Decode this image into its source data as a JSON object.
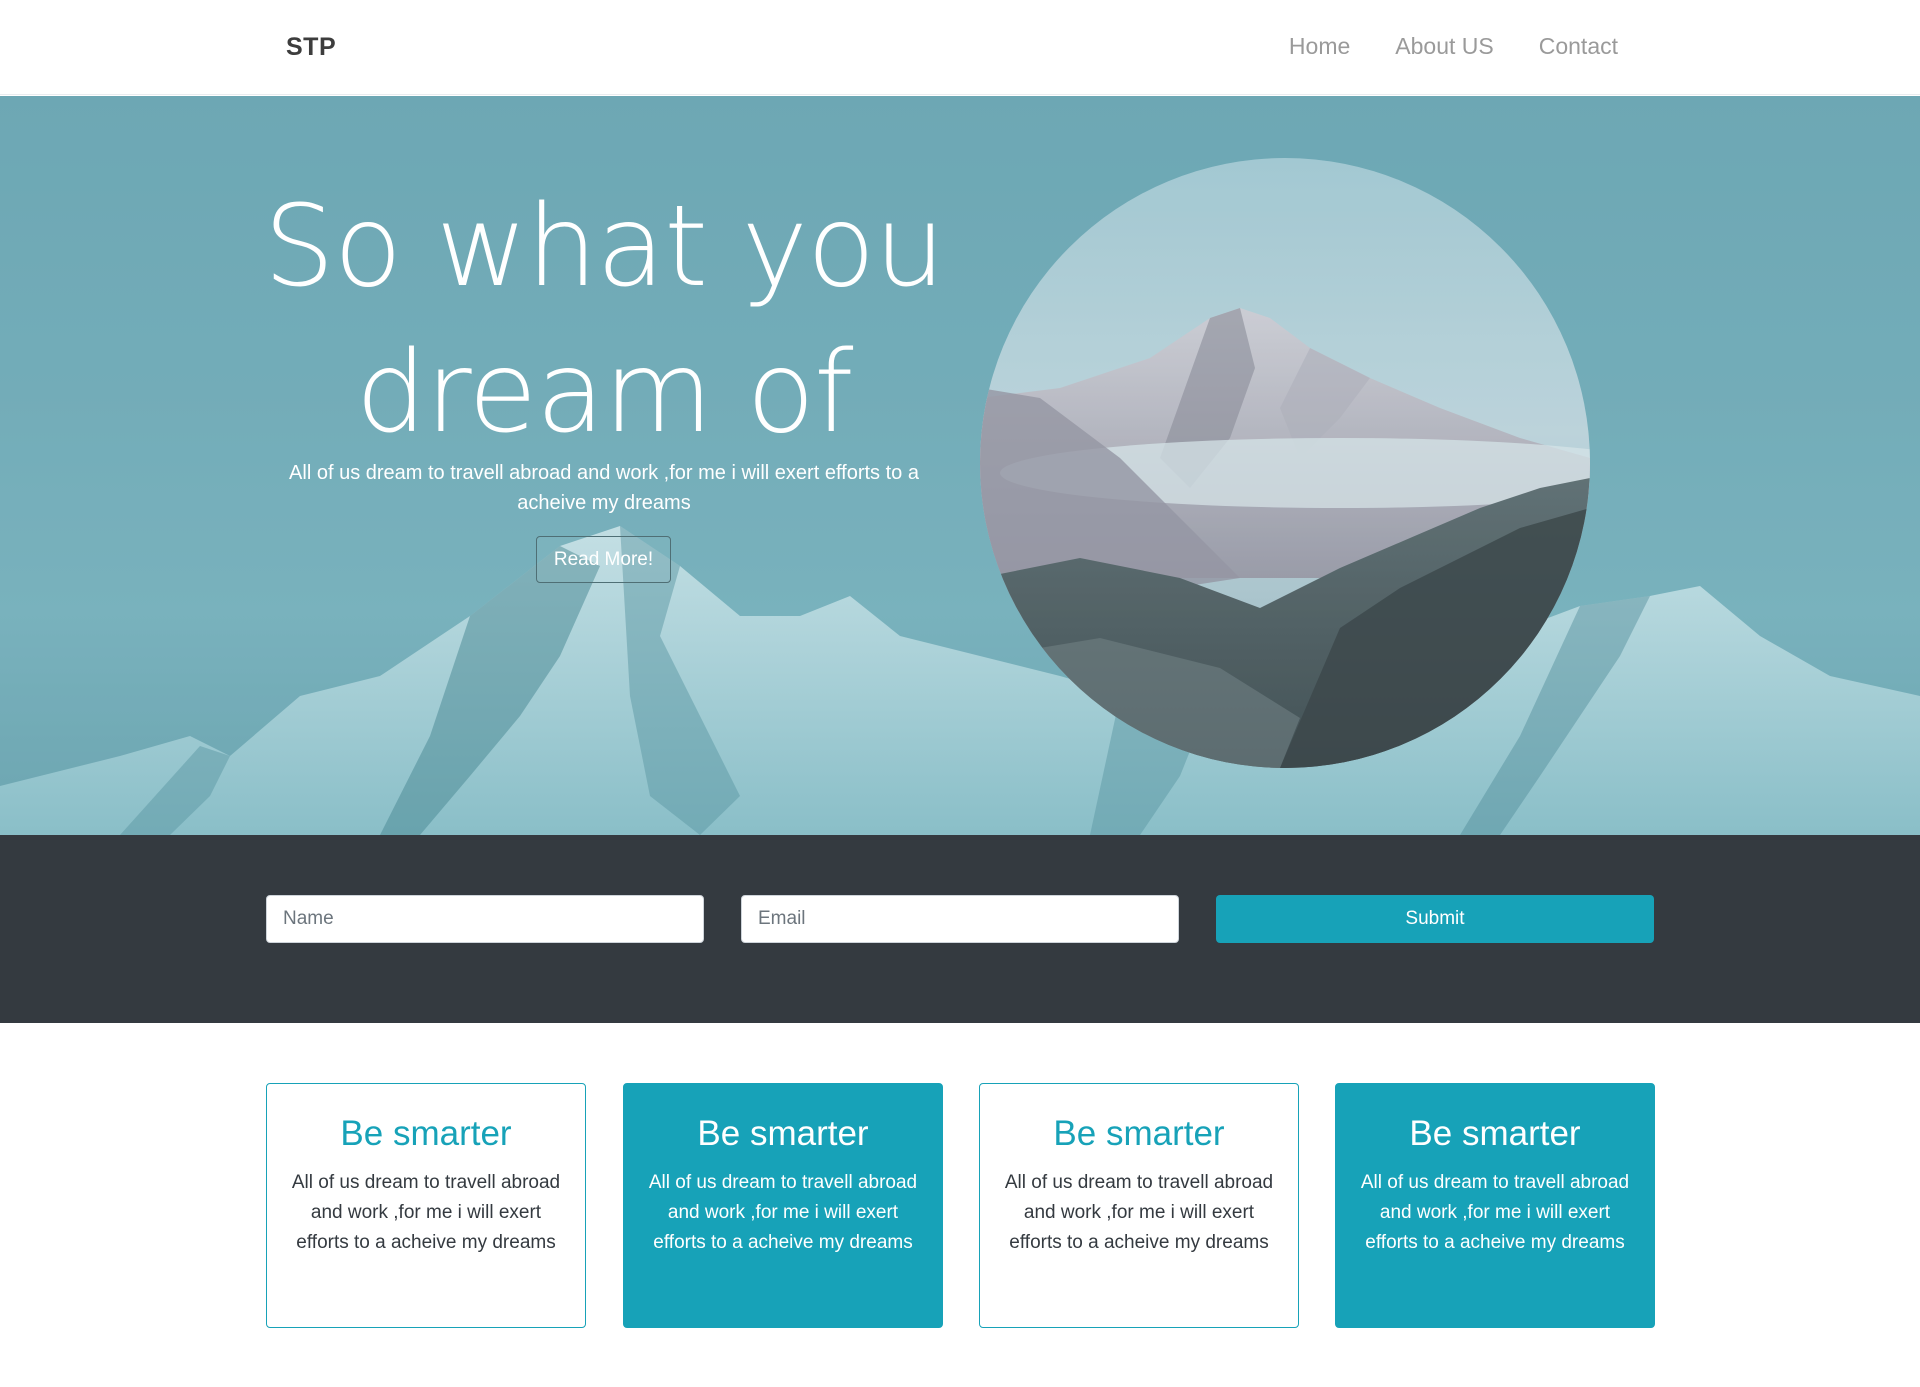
{
  "navbar": {
    "brand": "STP",
    "links": [
      "Home",
      "About US",
      "Contact"
    ]
  },
  "hero": {
    "title_line1": "So what you",
    "title_line2": "dream of",
    "subtitle": "All of us dream to travell abroad and work ,for me i will exert efforts to a acheive my dreams",
    "cta_label": "Read More!"
  },
  "form": {
    "name_placeholder": "Name",
    "email_placeholder": "Email",
    "submit_label": "Submit"
  },
  "cards": [
    {
      "title": "Be smarter",
      "text": "All of us dream to travell abroad and work ,for me i will exert efforts to a acheive my dreams"
    },
    {
      "title": "Be smarter",
      "text": "All of us dream to travell abroad and work ,for me i will exert efforts to a acheive my dreams"
    },
    {
      "title": "Be smarter",
      "text": "All of us dream to travell abroad and work ,for me i will exert efforts to a acheive my dreams"
    },
    {
      "title": "Be smarter",
      "text": "All of us dream to travell abroad and work ,for me i will exert efforts to a acheive my dreams"
    }
  ],
  "colors": {
    "accent": "#17a2b8",
    "dark_band": "#343a40",
    "hero_teal": "#73adb9"
  }
}
